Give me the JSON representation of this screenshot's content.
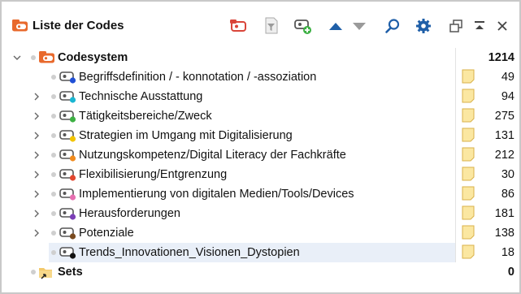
{
  "panel": {
    "title": "Liste der Codes"
  },
  "toolbar": {
    "buttons": [
      {
        "name": "new-code-icon"
      },
      {
        "name": "filter-icon"
      },
      {
        "name": "add-code-icon"
      },
      {
        "name": "move-up-icon"
      },
      {
        "name": "move-down-icon"
      },
      {
        "name": "search-icon"
      },
      {
        "name": "settings-icon"
      },
      {
        "name": "undock-icon"
      },
      {
        "name": "minimize-icon"
      },
      {
        "name": "close-icon"
      }
    ]
  },
  "colors": {
    "accent_orange": "#e8692c",
    "memo_yellow": "#fbe7a1",
    "selected_row": "#e9eff8",
    "arrow_blue": "#1f5fa8"
  },
  "tree": {
    "root": {
      "label": "Codesystem",
      "count": "1214"
    },
    "codes": [
      {
        "label": "Begriffsdefinition / - konnotation / -assoziation",
        "count": "49",
        "color": "#1f4fd6",
        "expandable": false
      },
      {
        "label": "Technische Ausstattung",
        "count": "94",
        "color": "#19b6d2",
        "expandable": true
      },
      {
        "label": "Tätigkeitsbereiche/Zweck",
        "count": "275",
        "color": "#3cb043",
        "expandable": true
      },
      {
        "label": "Strategien im Umgang mit Digitalisierung",
        "count": "131",
        "color": "#f2c400",
        "expandable": true
      },
      {
        "label": "Nutzungskompetenz/Digital Literacy der Fachkräfte",
        "count": "212",
        "color": "#f08a1c",
        "expandable": true
      },
      {
        "label": "Flexibilisierung/Entgrenzung",
        "count": "30",
        "color": "#e2472f",
        "expandable": true
      },
      {
        "label": "Implementierung von digitalen Medien/Tools/Devices",
        "count": "86",
        "color": "#e66fb0",
        "expandable": true
      },
      {
        "label": "Herausforderungen",
        "count": "181",
        "color": "#7b3fb6",
        "expandable": true
      },
      {
        "label": "Potenziale",
        "count": "138",
        "color": "#7a4a1e",
        "expandable": true
      },
      {
        "label": "Trends_Innovationen_Visionen_Dystopien",
        "count": "18",
        "color": "#111111",
        "expandable": false,
        "selected": true
      }
    ],
    "sets": {
      "label": "Sets",
      "count": "0"
    }
  }
}
